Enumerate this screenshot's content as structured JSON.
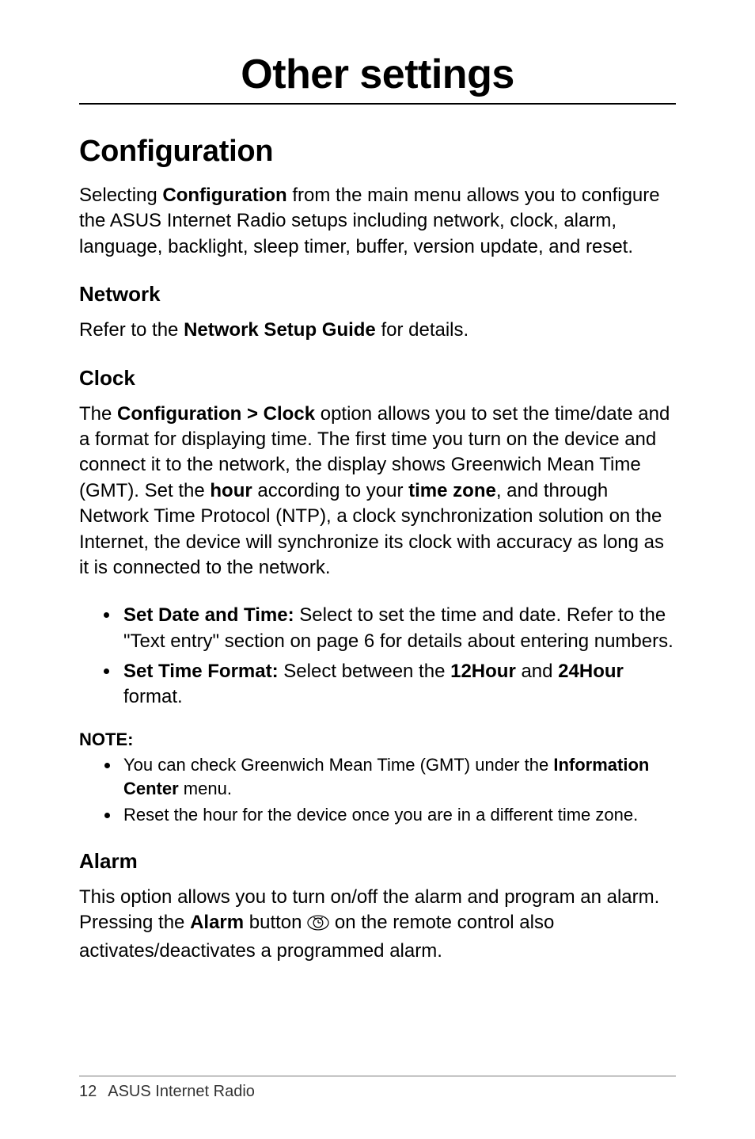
{
  "chapter_title": "Other settings",
  "section": {
    "title": "Configuration",
    "intro_pre": "Selecting ",
    "intro_bold": "Configuration",
    "intro_post": " from the main menu allows you to configure the ASUS Internet Radio setups including network, clock, alarm, language, backlight, sleep timer, buffer, version update, and reset."
  },
  "network": {
    "heading": "Network",
    "text_pre": "Refer to the ",
    "text_bold": "Network Setup Guide",
    "text_post": " for details."
  },
  "clock": {
    "heading": "Clock",
    "p1_pre": "The ",
    "p1_bold1": "Configuration > Clock",
    "p1_mid1": " option allows you to set the time/date and a format for displaying time. The first time you turn on the device and connect it to the network, the display shows Greenwich Mean Time (GMT). Set the ",
    "p1_bold2": "hour",
    "p1_mid2": " according to your ",
    "p1_bold3": "time zone",
    "p1_post": ", and through Network Time Protocol (NTP), a clock synchronization solution on the Internet, the device will synchronize its clock with accuracy as long as it is connected to the network.",
    "bullets": [
      {
        "bold": "Set Date and Time:",
        "rest": " Select to set the time and date. Refer to the \"Text entry\" section on page 6 for details about entering numbers."
      },
      {
        "bold": "Set Time Format:",
        "rest_pre": " Select between the ",
        "inner_bold1": "12Hour",
        "rest_mid": " and ",
        "inner_bold2": "24Hour",
        "rest_post": " format."
      }
    ],
    "note_label": "NOTE:",
    "note_bullets": [
      {
        "pre": "You can check Greenwich Mean Time (GMT) under the ",
        "bold": "Information Center",
        "post": " menu."
      },
      {
        "text": "Reset the hour for the device once you are in a different time zone."
      }
    ]
  },
  "alarm": {
    "heading": "Alarm",
    "p_pre": "This option allows you to turn on/off the alarm and program an alarm. Pressing the ",
    "p_bold": "Alarm",
    "p_mid": " button ",
    "p_post": " on the remote control also activates/deactivates a programmed alarm."
  },
  "footer": {
    "page_number": "12",
    "product": "ASUS Internet Radio"
  }
}
